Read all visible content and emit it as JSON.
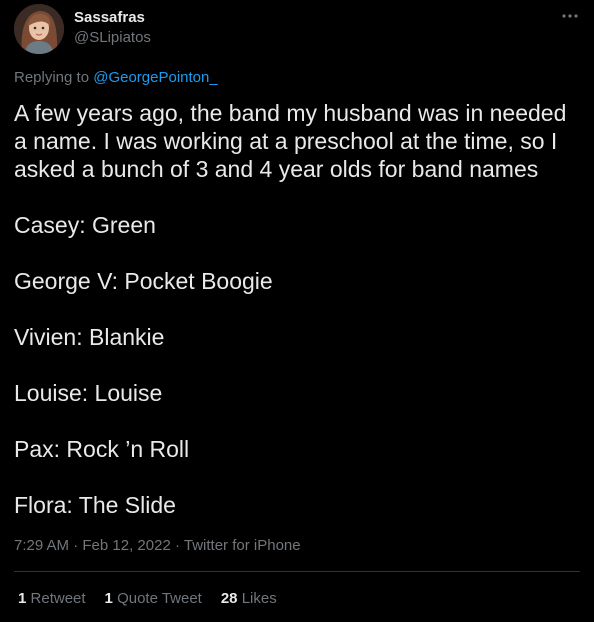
{
  "tweet": {
    "author": {
      "display_name": "Sassafras",
      "handle": "@SLipiatos",
      "avatar": "profile-photo"
    },
    "more_icon": "ellipsis-icon",
    "reply": {
      "prefix": "Replying to",
      "mention": "@GeorgePointon_"
    },
    "body": {
      "intro": "A few years ago, the band my husband was in needed a name. I was working at a preschool at the time, so I asked a bunch of 3 and 4 year olds for band names",
      "names": [
        "Casey: Green",
        "George V: Pocket Boogie",
        "Vivien: Blankie",
        "Louise: Louise",
        "Pax: Rock ’n Roll",
        "Flora: The Slide"
      ]
    },
    "meta": {
      "time": "7:29 AM",
      "separator": "·",
      "date": "Feb 12, 2022",
      "source": "Twitter for iPhone"
    },
    "stats": {
      "retweets": {
        "count": "1",
        "label": "Retweet"
      },
      "quote_tweets": {
        "count": "1",
        "label": "Quote Tweet"
      },
      "likes": {
        "count": "28",
        "label": "Likes"
      }
    }
  },
  "colors": {
    "background": "#000000",
    "text": "#e7e9ea",
    "secondary": "#71767b",
    "accent": "#1d9bf0",
    "divider": "#2f3336"
  }
}
